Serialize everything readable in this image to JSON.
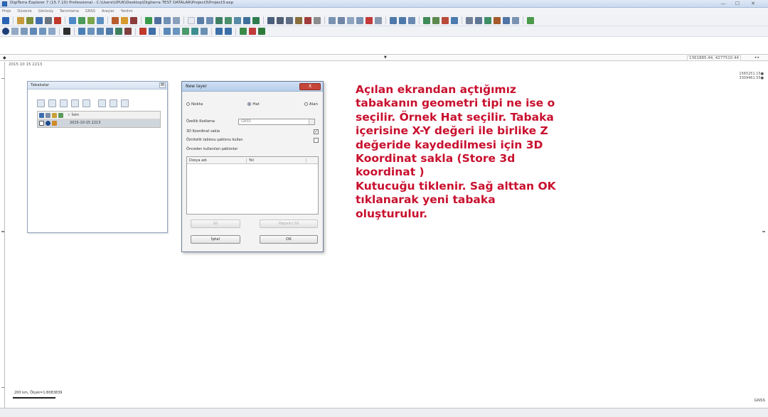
{
  "window": {
    "title": "DigiTerra Explorer 7 (15.7.10) Professional - C:\\Users\\UPUK\\Desktop\\Digiterra TEST DATALAR\\Project3\\Project3.exp",
    "min": "—",
    "max": "☐",
    "close": "✕"
  },
  "menu": [
    "Proje",
    "Düzenle",
    "Görünüş",
    "Tanımlama",
    "GNSS",
    "Araçlar",
    "Yardım"
  ],
  "ruler": {
    "left_mark": "◆",
    "center_mark": "▼",
    "coord_readout": "1361885.44, 4277510.44",
    "right_mark": "••"
  },
  "map": {
    "date_label": "2015 10 15 2213",
    "right_coords": [
      "1565251.15●",
      "3309461.55●"
    ],
    "scale_label": "200 km, Ölçek=1:8083839",
    "gnss": "GNSS"
  },
  "layers_panel": {
    "title": "Tabakalar",
    "close": "⊠",
    "header_row": "✓ İsim",
    "layer_name": "2015-10-15 2213"
  },
  "dialog": {
    "title": "New layer",
    "close": "X",
    "radios": [
      {
        "label": "Nokta",
        "selected": false
      },
      {
        "label": "Hat",
        "selected": true
      },
      {
        "label": "Alan",
        "selected": false
      }
    ],
    "symbol_label": "Özellik Kodlama",
    "symbol_value": "GNSS",
    "store3d_label": "3D Koordinat sakla",
    "store3d_checked": "✓",
    "table_template_label": "Öznitelik tablosu şablonu kullan",
    "recent_label": "Önceden kullanılan şablonlar",
    "grid_col1": "Dosya adı",
    "grid_col2": "Yol",
    "btn_sil": "Sil",
    "btn_hepsini_sil": "Hepsini Sil",
    "btn_iptal": "İptal",
    "btn_ok": "OK"
  },
  "annotation": "Açılan ekrandan açtığımız tabakanın geometri tipi ne ise o seçilir. Örnek Hat seçilir. Tabaka içerisine X-Y değeri ile birlike Z değeride kaydedilmesi için 3D Koordinat sakla (Store 3d koordinat )\nKutucuğu tiklenir. Sağ alttan OK tıklanarak yeni tabaka oluşturulur.",
  "colors": {
    "annotation": "#c8102e",
    "dialog_close": "#c7463a"
  }
}
